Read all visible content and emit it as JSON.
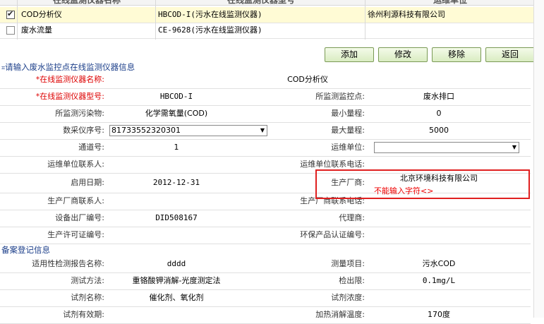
{
  "list": {
    "headers": [
      "在线监测仪器名称",
      "在线监测仪器型号",
      "运维单位"
    ],
    "rows": [
      {
        "name": "COD分析仪",
        "model": "HBCOD-I(污水在线监测仪器)",
        "unit": "徐州利源科技有限公司",
        "checked": true
      },
      {
        "name": "废水流量",
        "model": "CE-9628(污水在线监测仪器)",
        "unit": "",
        "checked": false
      }
    ]
  },
  "buttons": {
    "add": "添加",
    "edit": "修改",
    "remove": "移除",
    "back": "返回"
  },
  "section1": {
    "title": "请输入废水监控点在线监测仪器信息"
  },
  "form": {
    "name_label": "*在线监测仪器名称:",
    "name_value": "COD分析仪",
    "model_label": "*在线监测仪器型号:",
    "model_value": "HBCOD-I",
    "point_label": "所监测监控点:",
    "point_value": "废水排口",
    "pollutant_label": "所监测污染物:",
    "pollutant_value": "化学需氧量(COD)",
    "min_label": "最小量程:",
    "min_value": "0",
    "serial_label": "数采仪序号:",
    "serial_value": "81733552320301",
    "max_label": "最大量程:",
    "max_value": "5000",
    "channel_label": "通道号:",
    "channel_value": "1",
    "ops_unit_label": "运维单位:",
    "ops_unit_value": "",
    "ops_contact_label": "运维单位联系人:",
    "ops_contact_value": "",
    "ops_phone_label": "运维单位联系电话:",
    "ops_phone_value": "",
    "start_label": "启用日期:",
    "start_value": "2012-12-31",
    "maker_label": "生产厂商:",
    "maker_value": "北京环境科技有限公司",
    "maker_error": "不能输入字符<>",
    "maker_contact_label": "生产厂商联系人:",
    "maker_contact_value": "",
    "maker_phone_label": "生产厂商联系电话:",
    "maker_phone_value": "",
    "factory_no_label": "设备出厂编号:",
    "factory_no_value": "DID508167",
    "agent_label": "代理商:",
    "agent_value": "",
    "license_label": "生产许可证编号:",
    "license_value": "",
    "env_cert_label": "环保产品认证编号:",
    "env_cert_value": ""
  },
  "section2": {
    "title": "备案登记信息"
  },
  "record": {
    "report_label": "适用性检测报告名称:",
    "report_value": "dddd",
    "item_label": "测量项目:",
    "item_value": "污水COD",
    "method_label": "测试方法:",
    "method_value": "重铬酸钾消解-光度测定法",
    "limit_label": "检出限:",
    "limit_value": "0.1mg/L",
    "reagent_label": "试剂名称:",
    "reagent_value": "催化剂、氧化剂",
    "conc_label": "试剂浓度:",
    "conc_value": "",
    "validity_label": "试剂有效期:",
    "validity_value": "",
    "temp_label": "加热消解温度:",
    "temp_value": "170度"
  }
}
